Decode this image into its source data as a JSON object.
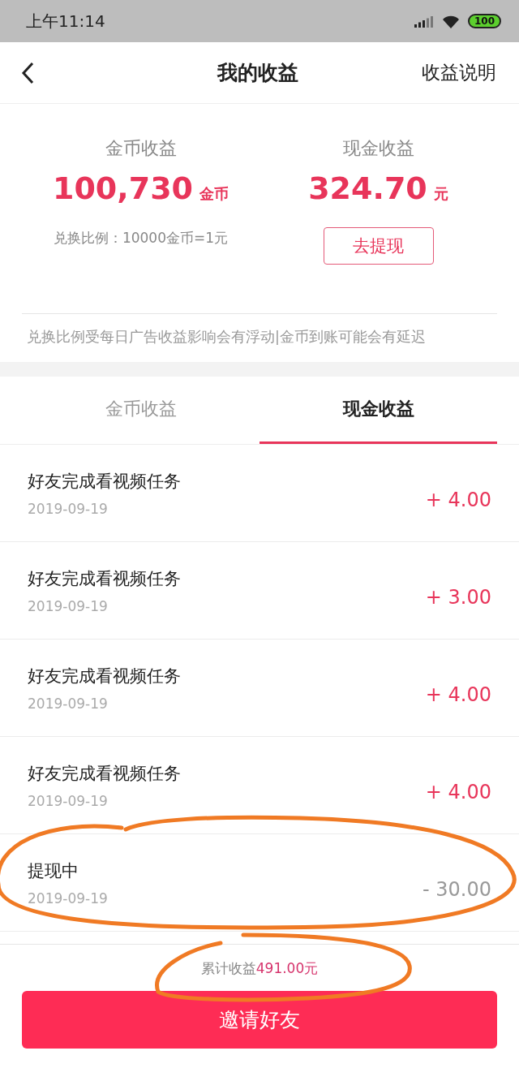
{
  "status_bar": {
    "time": "上午11:14",
    "battery": "100"
  },
  "header": {
    "title": "我的收益",
    "action": "收益说明"
  },
  "summary": {
    "coins": {
      "label": "金币收益",
      "value": "100,730",
      "unit": "金币",
      "note": "兑换比例：10000金币=1元"
    },
    "cash": {
      "label": "现金收益",
      "value": "324.70",
      "unit": "元",
      "button": "去提现"
    },
    "notice": "兑换比例受每日广告收益影响会有浮动|金币到账可能会有延迟"
  },
  "tabs": [
    {
      "label": "金币收益",
      "selected": false
    },
    {
      "label": "现金收益",
      "selected": true
    }
  ],
  "records": [
    {
      "title": "好友完成看视频任务",
      "date": "2019-09-19",
      "amount": "+ 4.00",
      "kind": "credit"
    },
    {
      "title": "好友完成看视频任务",
      "date": "2019-09-19",
      "amount": "+ 3.00",
      "kind": "credit"
    },
    {
      "title": "好友完成看视频任务",
      "date": "2019-09-19",
      "amount": "+ 4.00",
      "kind": "credit"
    },
    {
      "title": "好友完成看视频任务",
      "date": "2019-09-19",
      "amount": "+ 4.00",
      "kind": "credit"
    },
    {
      "title": "提现中",
      "date": "2019-09-19",
      "amount": "- 30.00",
      "kind": "withdrawal"
    }
  ],
  "footer": {
    "total_label": "累计收益",
    "total_value": "491.00元",
    "button": "邀请好友"
  }
}
